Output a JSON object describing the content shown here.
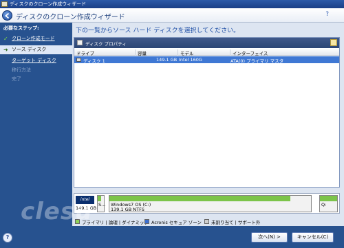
{
  "window": {
    "title": "ディスクのクローン作成ウィザード"
  },
  "header": {
    "title": "ディスクのクローン作成ウィザード",
    "help_icon": "?"
  },
  "sidebar": {
    "section_title": "必要なステップ:",
    "steps": [
      {
        "label": "クローン作成モード",
        "state": "done"
      },
      {
        "label": "ソース ディスク",
        "state": "active"
      },
      {
        "label": "ターゲット ディスク",
        "state": "link"
      },
      {
        "label": "移行方法",
        "state": "disabled"
      },
      {
        "label": "完了",
        "state": "disabled"
      }
    ]
  },
  "main": {
    "instruction": "下の一覧からソース ハード ディスクを選択してください。",
    "toolbar": {
      "properties_label": "ディスク プロパティ"
    },
    "columns": [
      "ドライブ",
      "容量",
      "モデル",
      "インターフェイス"
    ],
    "rows": [
      {
        "drive": "ディスク 1",
        "capacity": "149.1 GB",
        "model": "Intel 160G",
        "interface": "ATA(0) プライマリ マスタ"
      }
    ]
  },
  "diskmap": {
    "brand": "intel",
    "disk_size": "149.1 GB",
    "small_partition_label": "S...",
    "partition_label": "Windows7 OS (C:)",
    "partition_detail": "139.1 GB  NTFS",
    "last_partition_label": "Q:",
    "colors": {
      "used": "#7cc44a",
      "free": "#f2f2f2"
    }
  },
  "legend": {
    "items": [
      {
        "label": "プライマリ | 論理 | ダイナミック",
        "color": "#8fd35a"
      },
      {
        "label": "Acronis セキュア ゾーン",
        "color": "#3b6fd1"
      },
      {
        "label": "未割り当て | サポート外",
        "color": "#cfcfcf"
      }
    ]
  },
  "footer": {
    "help_label": "?",
    "next_label": "次へ(N) >",
    "cancel_label": "キャンセル(C)"
  },
  "watermark": "clesu"
}
